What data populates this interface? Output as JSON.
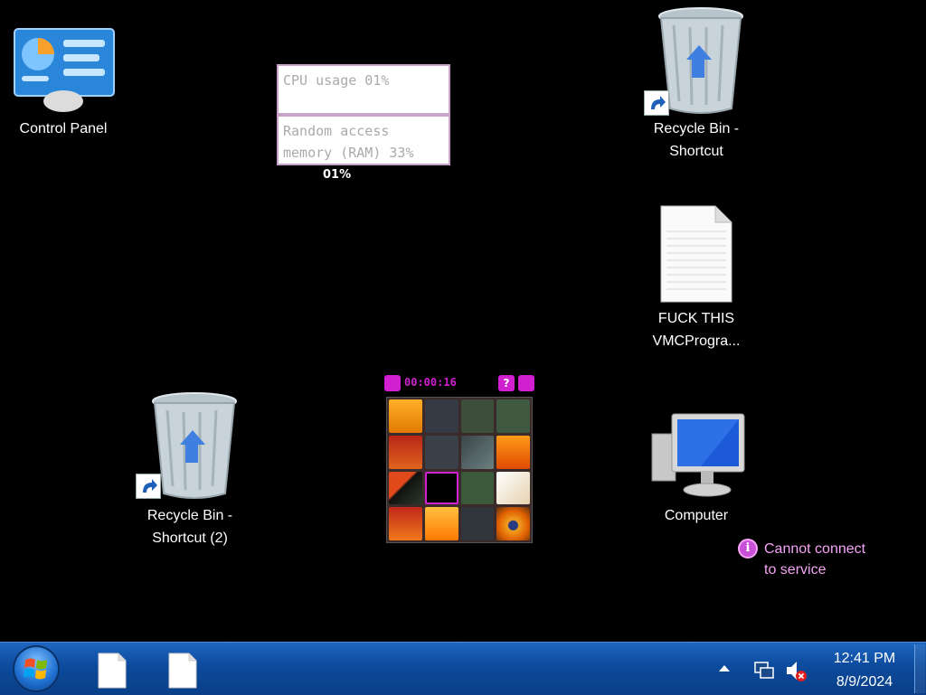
{
  "desktop": {
    "icons": [
      {
        "label_line1": "Control Panel",
        "label_line2": ""
      },
      {
        "label_line1": "Recycle Bin -",
        "label_line2": "Shortcut"
      },
      {
        "label_line1": "FUCK THIS",
        "label_line2": "VMCProgra..."
      },
      {
        "label_line1": "Recycle Bin -",
        "label_line2": "Shortcut (2)"
      },
      {
        "label_line1": "Computer",
        "label_line2": ""
      }
    ]
  },
  "monitor_gadget": {
    "cpu_text": "CPU usage 01%",
    "ram_line1": "Random access",
    "ram_line2": "memory (RAM) 33%",
    "sub_value": "01%"
  },
  "puzzle_gadget": {
    "timer": "00:00:16",
    "help_label": "?",
    "colors": {
      "frame": "#d020d0"
    }
  },
  "notice": {
    "line1": "Cannot connect",
    "line2": "to service",
    "icon": "info-icon"
  },
  "taskbar": {
    "time": "12:41 PM",
    "date": "8/9/2024",
    "start_icon": "windows-logo-icon",
    "pinned": [
      "file-icon",
      "file-icon"
    ],
    "tray_icons": [
      "show-hidden-icons-arrow",
      "network-icon",
      "volume-muted-icon"
    ]
  }
}
